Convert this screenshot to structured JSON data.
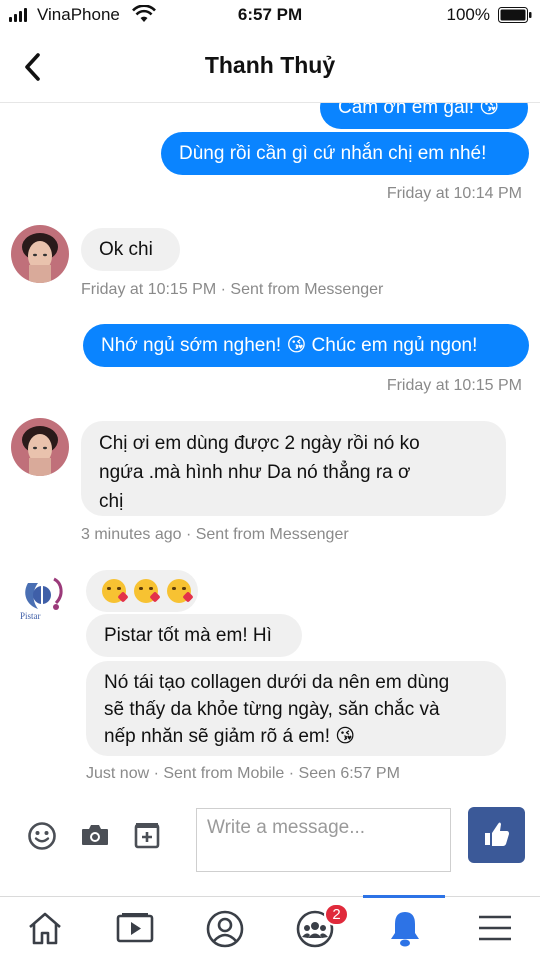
{
  "status_bar": {
    "carrier": "VinaPhone",
    "time": "6:57 PM",
    "battery": "100%"
  },
  "header": {
    "title": "Thanh Thuỷ"
  },
  "messages": [
    {
      "type": "out",
      "text": "Cảm ơn em gái! 😘"
    },
    {
      "type": "out",
      "text": "Dùng rồi cần gì cứ nhắn chị em nhé!"
    },
    {
      "type": "timestamp",
      "text": "Friday at 10:14 PM"
    },
    {
      "type": "in",
      "text": "Ok  chi"
    },
    {
      "type": "meta",
      "text": "Friday at 10:15 PM · Sent from Messenger"
    },
    {
      "type": "out",
      "text": "Nhớ ngủ sớm nghen! 😘 Chúc em ngủ ngon!"
    },
    {
      "type": "timestamp",
      "text": "Friday at 10:15 PM"
    },
    {
      "type": "in",
      "lines": [
        "Chị ơi em dùng được 2 ngày rồi nó ko",
        "ngứa .mà hình như Da nó thẳng ra ơ",
        "chị"
      ]
    },
    {
      "type": "meta",
      "text": "3 minutes ago · Sent from Messenger"
    },
    {
      "type": "in",
      "text": "😘😘😘"
    },
    {
      "type": "in",
      "text": "Pistar tốt mà em! Hì"
    },
    {
      "type": "in",
      "lines": [
        "Nó tái tạo collagen dưới da nên em dùng",
        "sẽ thấy da khỏe từng ngày, săn chắc và",
        "nếp nhăn sẽ giảm rõ á em! 😘"
      ]
    },
    {
      "type": "meta",
      "text": "Just now · Sent from Mobile · Seen 6:57 PM"
    }
  ],
  "sender_logo": {
    "text": "Pistar"
  },
  "composer": {
    "placeholder": "Write a message..."
  },
  "tabbar": {
    "items": [
      "home-icon",
      "video-icon",
      "profile-icon",
      "groups-icon",
      "notifications-icon",
      "menu-icon"
    ],
    "groups_badge": "2",
    "active": "notifications-icon"
  },
  "colors": {
    "outgoing_bubble": "#0a84ff",
    "incoming_bubble": "#f0f0f0",
    "like_button": "#3b5998",
    "badge": "#e02a3b"
  }
}
